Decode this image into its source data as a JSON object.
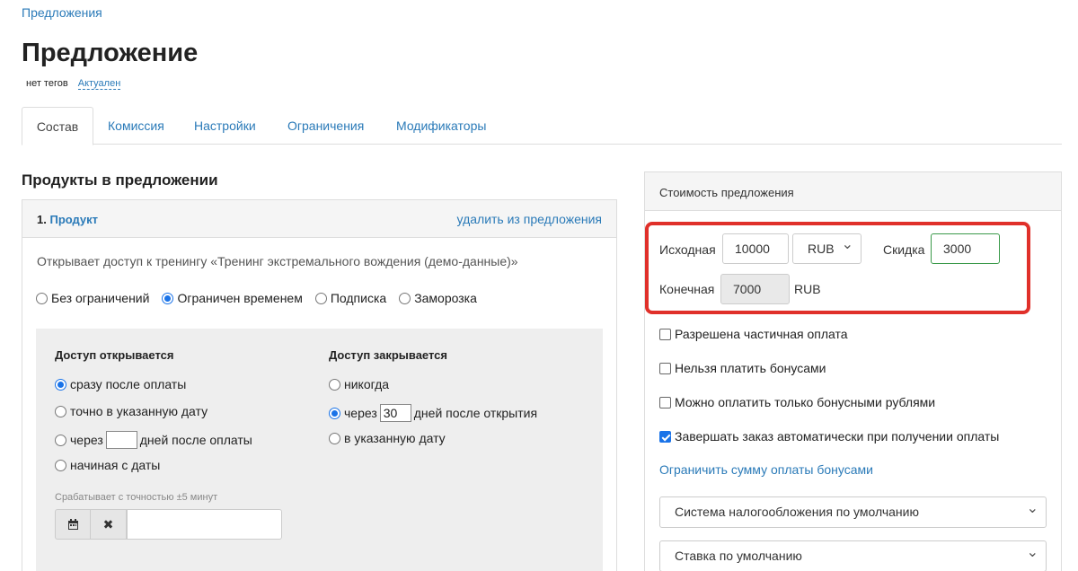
{
  "breadcrumb": "Предложения",
  "title": "Предложение",
  "tags": {
    "no_tags": "нет тегов",
    "status": "Актуален"
  },
  "tabs": [
    "Состав",
    "Комиссия",
    "Настройки",
    "Ограничения",
    "Модификаторы"
  ],
  "products_section": {
    "title": "Продукты в предложении",
    "product_number": "1.",
    "product_name": "Продукт",
    "remove_label": "удалить из предложения",
    "description": "Открывает доступ к тренингу «Тренинг экстремального вождения (демо-данные)»",
    "access_types": [
      {
        "label": "Без ограничений",
        "checked": false
      },
      {
        "label": "Ограничен временем",
        "checked": true
      },
      {
        "label": "Подписка",
        "checked": false
      },
      {
        "label": "Заморозка",
        "checked": false
      }
    ],
    "access_open": {
      "title": "Доступ открывается",
      "opt_immediately": "сразу после оплаты",
      "opt_exact_date": "точно в указанную дату",
      "opt_after_prefix": "через",
      "opt_after_value": "",
      "opt_after_suffix": "дней после оплаты",
      "opt_from_date": "начиная с даты",
      "hint": "Срабатывает с точностью ±5 минут",
      "date_value": ""
    },
    "access_close": {
      "title": "Доступ закрывается",
      "opt_never": "никогда",
      "opt_after_prefix": "через",
      "opt_after_value": "30",
      "opt_after_suffix": "дней после открытия",
      "opt_date": "в указанную дату"
    }
  },
  "cost": {
    "title": "Стоимость предложения",
    "original_label": "Исходная",
    "original_value": "10000",
    "currency": "RUB",
    "discount_label": "Скидка",
    "discount_value": "3000",
    "final_label": "Конечная",
    "final_value": "7000",
    "final_currency": "RUB",
    "checkboxes": [
      {
        "label": "Разрешена частичная оплата",
        "checked": false
      },
      {
        "label": "Нельзя платить бонусами",
        "checked": false
      },
      {
        "label": "Можно оплатить только бонусными рублями",
        "checked": false
      },
      {
        "label": "Завершать заказ автоматически при получении оплаты",
        "checked": true
      }
    ],
    "limit_link": "Ограничить сумму оплаты бонусами",
    "tax_system": "Система налогообложения по умолчанию",
    "vat_rate": "Ставка по умолчанию"
  },
  "colors": {
    "link": "#2a7ab8",
    "highlight": "#e0302a",
    "discount_border": "#3a9a4a",
    "radio_checked": "#1a73e8"
  }
}
